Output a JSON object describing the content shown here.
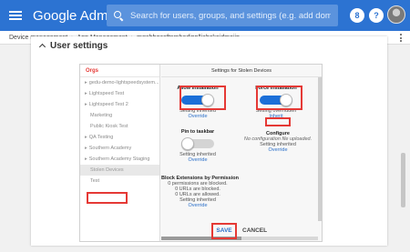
{
  "header": {
    "brand_google": "Google",
    "brand_admin": "Admin",
    "search_placeholder": "Search for users, groups, and settings (e.g. add domain alias)",
    "badge_icon": "8",
    "help_icon": "?"
  },
  "breadcrumb": {
    "items": [
      "Device management",
      "App Management",
      "mgabhgcoftnmhodjpplliahckojdmojjp"
    ]
  },
  "page": {
    "title": "User settings"
  },
  "orgs": {
    "header": "Orgs",
    "items": [
      {
        "label": "gedu-demo-lightspeedsystem...",
        "expandable": true
      },
      {
        "label": "Lightspeed Test",
        "expandable": true
      },
      {
        "label": "Lightspeed Test 2",
        "expandable": true
      },
      {
        "label": "Marketing",
        "expandable": false
      },
      {
        "label": "Public Kiosk Test",
        "expandable": false
      },
      {
        "label": "QA Testing",
        "expandable": true
      },
      {
        "label": "Southern Academy",
        "expandable": true
      },
      {
        "label": "Southern Academy Staging",
        "expandable": true
      },
      {
        "label": "Stolen Devices",
        "expandable": false,
        "selected": true
      },
      {
        "label": "Test",
        "expandable": false
      }
    ]
  },
  "settings": {
    "header": "Settings for Stolen Devices",
    "allow_installation": {
      "label": "Allow installation",
      "status": "Setting inherited",
      "action": "Override",
      "enabled": true
    },
    "force_installation": {
      "label": "Force installation",
      "status": "Setting overridden",
      "action": "Inherit",
      "enabled": true
    },
    "pin_to_taskbar": {
      "label": "Pin to taskbar",
      "status": "Setting inherited",
      "action": "Override",
      "enabled": false
    },
    "configure": {
      "label": "Configure",
      "note": "No configuration file uploaded.",
      "status": "Setting inherited",
      "action": "Override"
    },
    "block_extensions": {
      "label": "Block Extensions by Permission",
      "lines": [
        "0 permissions are blocked.",
        "0 URLs are blocked.",
        "0 URLs are allowed."
      ],
      "status": "Setting inherited",
      "action": "Override"
    }
  },
  "actions": {
    "save": "SAVE",
    "cancel": "CANCEL"
  },
  "colors": {
    "header_bg": "#2c73d2",
    "accent_red": "#e53935",
    "toggle_on": "#1b6fd8",
    "link": "#2a6fc9"
  }
}
